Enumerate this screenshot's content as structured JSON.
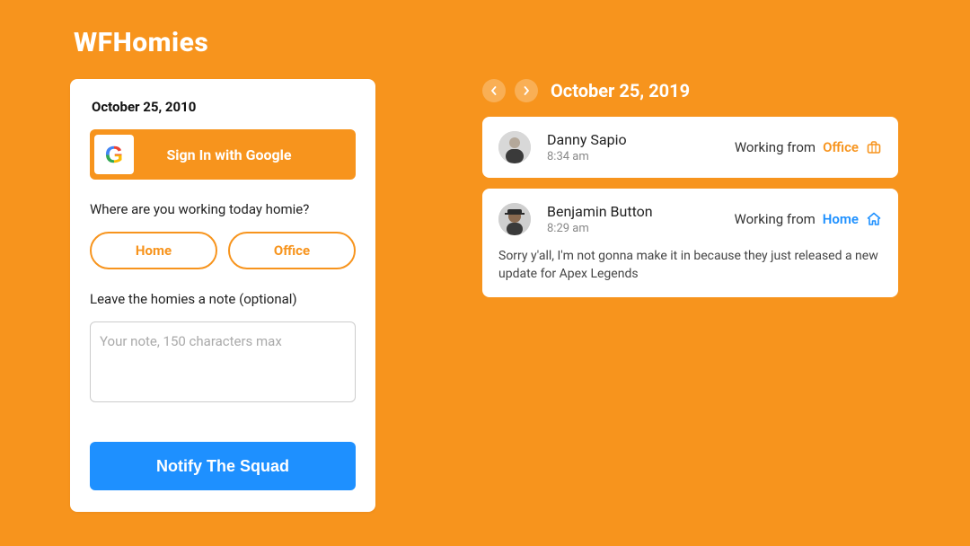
{
  "app": {
    "title": "WFHomies"
  },
  "left": {
    "date": "October 25, 2010",
    "google_label": "Sign In with Google",
    "question": "Where are you working today homie?",
    "option_home": "Home",
    "option_office": "Office",
    "note_label": "Leave the homies a note (optional)",
    "note_placeholder": "Your note, 150 characters max",
    "notify_label": "Notify The Squad"
  },
  "header": {
    "date": "October 25, 2019"
  },
  "statuses": [
    {
      "name": "Danny Sapio",
      "time": "8:34 am",
      "prefix": "Working from ",
      "location": "Office",
      "location_type": "office",
      "note": ""
    },
    {
      "name": "Benjamin Button",
      "time": "8:29 am",
      "prefix": "Working from ",
      "location": "Home",
      "location_type": "home",
      "note": "Sorry y'all, I'm not gonna make it in because they just released a new update for Apex Legends"
    }
  ],
  "colors": {
    "brand_orange": "#f7941d",
    "brand_blue": "#1e90ff"
  }
}
